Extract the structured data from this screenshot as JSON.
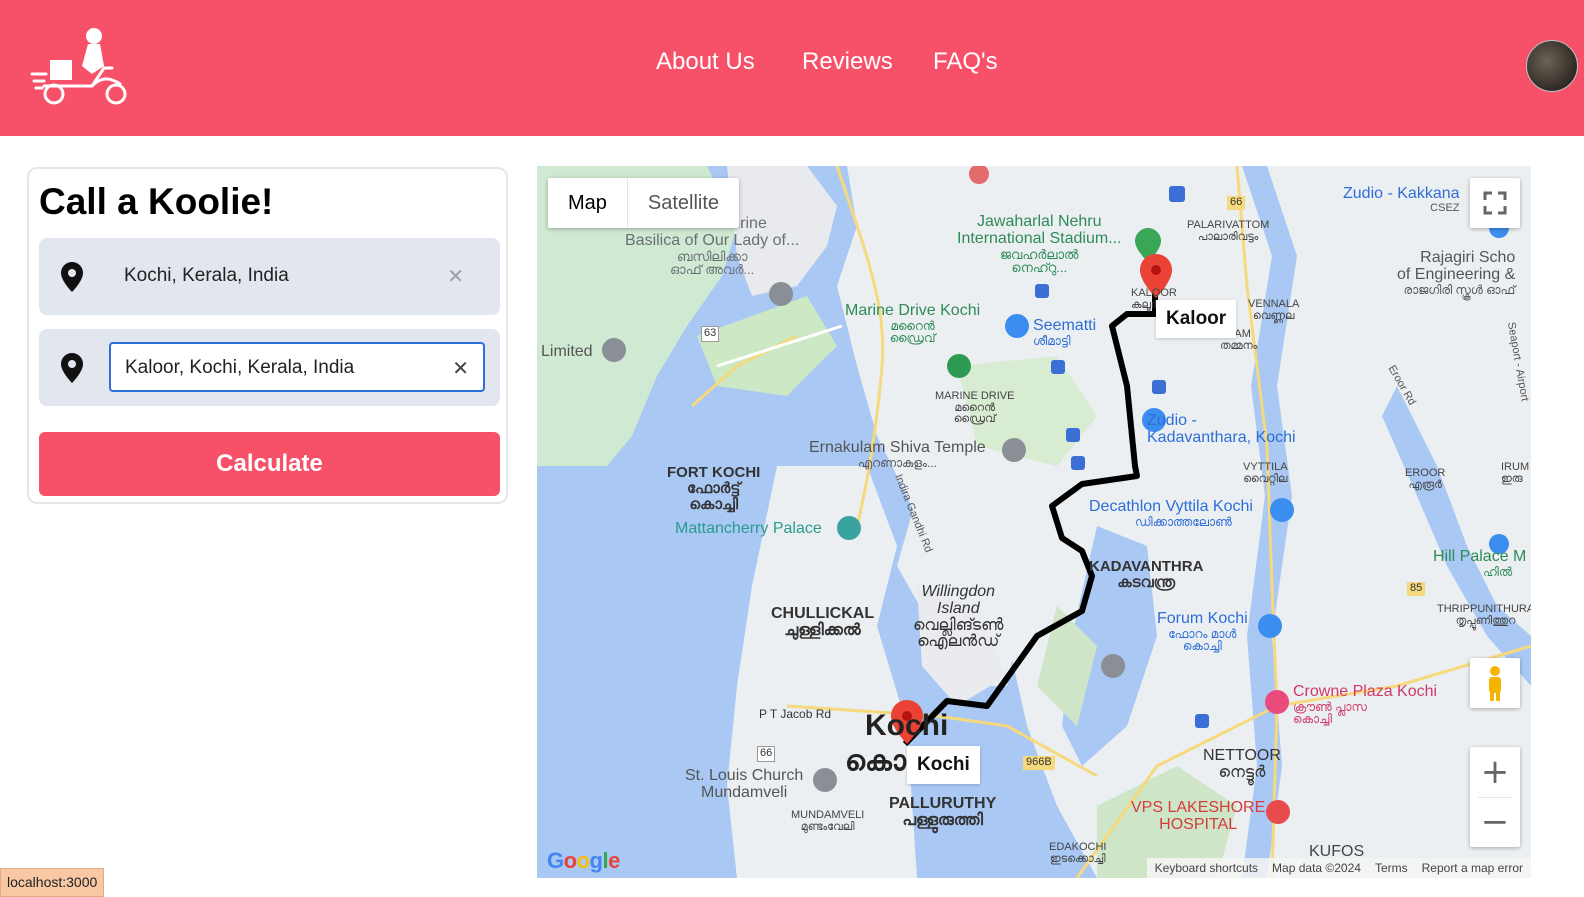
{
  "header": {
    "nav": [
      {
        "label": "About Us"
      },
      {
        "label": "Reviews"
      },
      {
        "label": "FAQ's"
      }
    ],
    "brand_color": "#f7516a"
  },
  "panel": {
    "title": "Call a Koolie!",
    "origin": {
      "value": "Kochi, Kerala, India"
    },
    "destination": {
      "value": "Kaloor, Kochi, Kerala, India"
    },
    "clear_symbol": "✕",
    "calculate_label": "Calculate"
  },
  "map": {
    "type_control": {
      "map": "Map",
      "satellite": "Satellite"
    },
    "zoom_in": "+",
    "zoom_out": "−",
    "route": {
      "start_label": "Kochi",
      "end_label": "Kaloor"
    },
    "labels": [
      "National Shrine",
      "Basilica of Our Lady of...",
      "ബസിലിക്കാ",
      "ഓഫ് അവർ...",
      "Jawaharlal Nehru",
      "International Stadium...",
      "ജവഹർലാൽ",
      "നെഹ്റു...",
      "PALARIVATTOM",
      "പാലാരിവട്ടം",
      "Zudio - Kakkana",
      "CSEZ",
      "Rajagiri Scho",
      "of Engineering &",
      "രാജഗിരി സ്കൂൾ ഓഫ്",
      "Limited",
      "Marine Drive Kochi",
      "മറൈൻ",
      "ഡ്രൈവ്",
      "Seematti",
      "ശീമാട്ടി",
      "KALOOR",
      "കലൂർ",
      "VENNALA",
      "വെണ്ണല",
      "NAM",
      "തമ്മനം",
      "MARINE DRIVE",
      "മറൈൻ",
      "ഡ്രൈവ്",
      "Zudio -",
      "Kadavanthara, Kochi",
      "Eroor Rd",
      "Seaport - Airport",
      "Ernakulam Shiva Temple",
      "എറണാകുളം...",
      "FORT KOCHI",
      "ഫോർട്ട്",
      "കൊച്ചി",
      "Mattancherry Palace",
      "Indira Gandhi Rd",
      "Decathlon Vyttila Kochi",
      "ഡിക്കാത്തലോൺ",
      "VYTTILA",
      "വൈറ്റില",
      "EROOR",
      "എരൂർ",
      "IRUM",
      "ഇരു",
      "KADAVANTHRA",
      "കടവന്ത്ര",
      "Hill Palace M",
      "ഹിൽ",
      "Willingdon",
      "Island",
      "വെല്ലിങ്ടൺ",
      "ഐലൻഡ്",
      "CHULLICKAL",
      "ചുള്ളിക്കൽ",
      "Forum Kochi",
      "ഫോറം മാൾ",
      "കൊച്ചി",
      "THRIPPUNITHURA",
      "തൃപ്പൂണിത്തുറ",
      "Crowne Plaza Kochi",
      "ക്രൗൺ പ്ലാസ",
      "കൊച്ചി",
      "P T Jacob Rd",
      "Kochi",
      "കൊ",
      "NETTOOR",
      "നെട്ടൂർ",
      "St. Louis Church",
      "Mundamveli",
      "MUNDAMVELI",
      "മുണ്ടംവേലി",
      "PALLURUTHY",
      "പള്ളുരുത്തി",
      "VPS LAKESHORE",
      "HOSPITAL",
      "EDAKOCHI",
      "ഇടക്കൊച്ചി",
      "KUFOS",
      "63",
      "66",
      "966B",
      "85"
    ],
    "google": "Google",
    "footer": [
      "Keyboard shortcuts",
      "Map data ©2024",
      "Terms",
      "Report a map error"
    ]
  },
  "status_bar": "localhost:3000"
}
